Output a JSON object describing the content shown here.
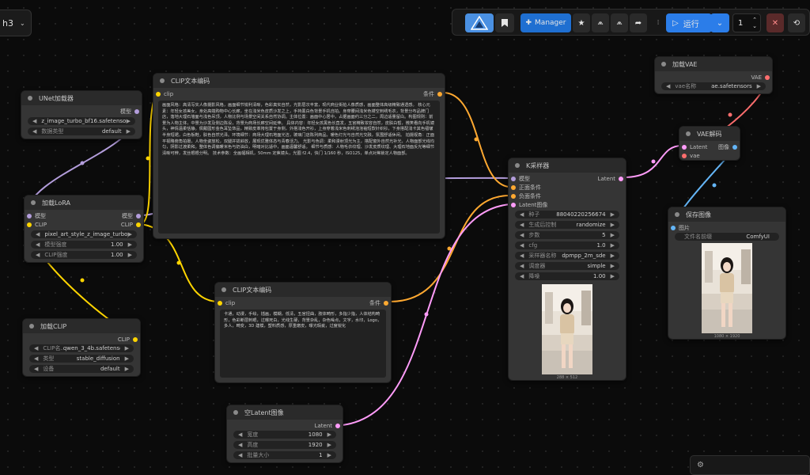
{
  "app": {
    "workflow_tab": "h3"
  },
  "toolbar": {
    "manager_label": "Manager",
    "run_label": "运行",
    "queue_count": "1"
  },
  "nodes": {
    "unet_loader": {
      "title": "UNet加载器",
      "output": "模型",
      "widgets": [
        {
          "key": "",
          "value": "z_image_turbo_bf16.safetensors"
        },
        {
          "key": "数据类型",
          "value": "default"
        }
      ]
    },
    "clip_text_1": {
      "title": "CLIP文本编码",
      "input": "clip",
      "output": "条件",
      "text": "画面风格：高清写实人像摄影风格，画面细节锐利清晰，色彩真实自然，光影层次丰富，现代商业街拍人像质感，画面整体高级精致通透感。 核心元素：年轻女孩美女，身处高端购物中心长廊，坐在浅米色皮质沙发之上，手持黑白色背景手机自拍。身穿腰间浅米色镂空刺绣毛衣，背景分布品牌门店，落地大理石墙面与浅色吊顶，人物比例与场景空间关系自然协调。主体位置：画面中心居中，占据画面约三分之二，周边适量留白。构图规则：前景为人物主体，中景为沙发及侧边陈设，背景为商场长廊空间延伸。 具体内容：年轻女孩黑色长直发，五官精致妆容自然，皮肤白皙，微笑看向手机镜头，神情温柔恬静。佩戴圆形金色耳坠饰品，精致皮革挎包置于身侧，外搭浅色开衫，上身穿着浅米色刺绣泡泡袖短款针织衫，下身搭配浅卡其色褶皱半身短裙，白色板鞋，肤色自然光泽。环境细节：商场大理石地面光洁，玻璃门店陈列商品，暖色灯光与自然光交融，氛围舒适休闲。 拍摄视角：正面平视略俯角拍摄，人物坐姿放松，双腿并拢斜放，展现优雅体态与青春活力。 光影与色调：柔和漫射顶光为主，搭配窗外自然光补光，人物面部光线均匀，阴影过渡柔和。整体色调偏暖米色与奶油白，明暗对比适中，画面温馨舒适。 细节与质感：人物毛衣纹理、沙发皮质纹理、大理石地面反光等细节清晰可辨，发丝根根分明。 技术参数：全画幅相机，50mm 定焦镜头，光圈 f2.4，快门 1/160 秒，ISO125，单点对焦锁定人物面部。"
    },
    "lora": {
      "title": "加载LoRA",
      "inputs": [
        "模型",
        "CLIP"
      ],
      "outputs": [
        "模型",
        "CLIP"
      ],
      "widgets": [
        {
          "key": "",
          "value": "pixel_art_style_z_image_turbo_…"
        },
        {
          "key": "模型强度",
          "value": "1.00"
        },
        {
          "key": "CLIP强度",
          "value": "1.00"
        }
      ]
    },
    "clip_loader": {
      "title": "加载CLIP",
      "output": "CLIP",
      "widgets": [
        {
          "key": "CLIP名…",
          "value": "qwen_3_4b.safetensors"
        },
        {
          "key": "类型",
          "value": "stable_diffusion"
        },
        {
          "key": "设备",
          "value": "default"
        }
      ]
    },
    "clip_text_2": {
      "title": "CLIP文本编码",
      "input": "clip",
      "output": "条件",
      "text": "卡通，动漫，手绘，插画，模糊，低清，五官扭曲，肢体畸形，多指少指，人体结构畸形，色彩断层刺眼，过曝死白，光线生硬，背景杂乱，杂色噪点，文字，水印，Logo，多人，畸变，3D 建模，塑料质感，厚重磨皮，曝光瑕疵，过度锐化"
    },
    "ksampler": {
      "title": "K采样器",
      "inputs": [
        "模型",
        "正面条件",
        "负面条件",
        "Latent图像"
      ],
      "output": "Latent",
      "widgets": [
        {
          "key": "种子",
          "value": "88040220256674"
        },
        {
          "key": "生成后控制",
          "value": "randomize"
        },
        {
          "key": "步数",
          "value": "5"
        },
        {
          "key": "cfg",
          "value": "1.0"
        },
        {
          "key": "采样器名称",
          "value": "dpmpp_2m_sde"
        },
        {
          "key": "调度器",
          "value": "simple"
        },
        {
          "key": "降噪",
          "value": "1.00"
        }
      ],
      "preview_caption": "288 × 512"
    },
    "empty_latent": {
      "title": "空Latent图像",
      "output": "Latent",
      "widgets": [
        {
          "key": "宽度",
          "value": "1080"
        },
        {
          "key": "高度",
          "value": "1920"
        },
        {
          "key": "批量大小",
          "value": "1"
        }
      ]
    },
    "vae_loader": {
      "title": "加载VAE",
      "output": "VAE",
      "widgets": [
        {
          "key": "vae名称",
          "value": "ae.safetensors"
        }
      ]
    },
    "vae_decode": {
      "title": "VAE解码",
      "inputs": [
        "Latent",
        "vae"
      ],
      "output": "图像"
    },
    "save_image": {
      "title": "保存图像",
      "input": "图片",
      "widgets": [
        {
          "key": "文件名前缀",
          "value": "ComfyUI"
        }
      ],
      "preview_caption": "1080 × 1920"
    }
  },
  "colors": {
    "model": "#b39ddb",
    "clip": "#ffd500",
    "conditioning": "#ffa931",
    "latent": "#ff9cf9",
    "vae": "#ff6e6e",
    "image": "#64b5f6",
    "run_button": "#2b7de9",
    "accent_blue": "#1f6fd1"
  }
}
